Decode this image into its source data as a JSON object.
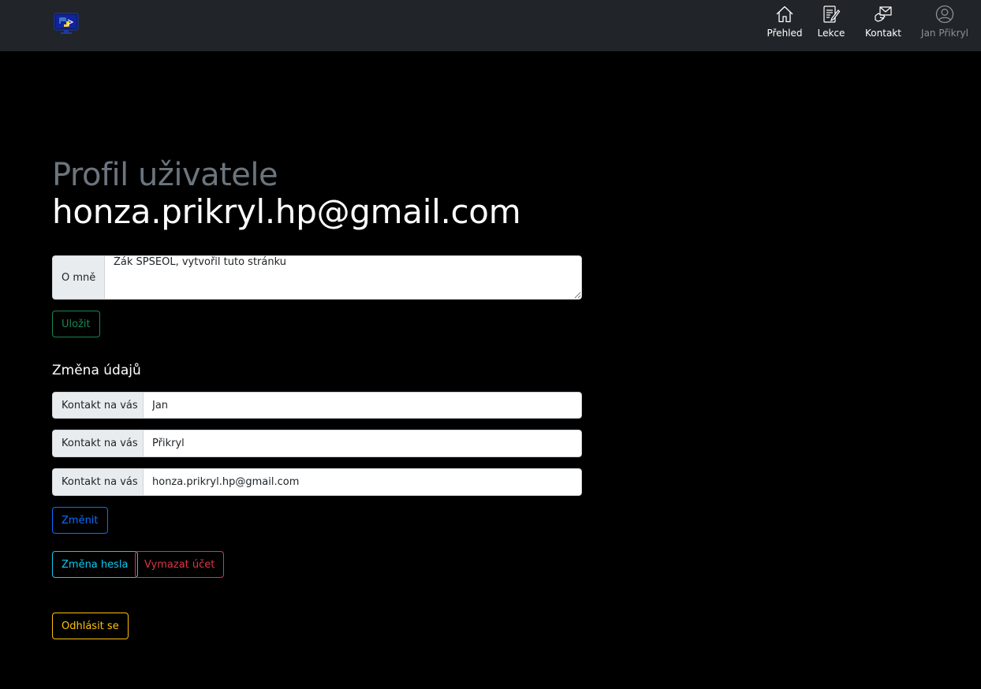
{
  "nav": {
    "items": [
      {
        "label": "Přehled",
        "icon": "house-icon"
      },
      {
        "label": "Lekce",
        "icon": "journal-pencil-icon"
      },
      {
        "label": "Kontakt",
        "icon": "envelope-handshake-icon"
      },
      {
        "label": "Jan Přikryl",
        "icon": "person-circle-icon"
      }
    ]
  },
  "header": {
    "subtitle": "Profil uživatele",
    "title": "honza.prikryl.hp@gmail.com"
  },
  "about": {
    "label": "O mně",
    "value": "Žák SPŠEOL, vytvořil tuto stránku",
    "save_label": "Uložit"
  },
  "details": {
    "heading": "Změna údajů",
    "first_name": {
      "label": "Kontakt na vás",
      "value": "Jan"
    },
    "last_name": {
      "label": "Kontakt na vás",
      "value": "Přikryl"
    },
    "email": {
      "label": "Kontakt na vás",
      "value": "honza.prikryl.hp@gmail.com"
    },
    "change_label": "Změnit"
  },
  "account": {
    "password_label": "Změna hesla",
    "delete_label": "Vymazat účet",
    "logout_label": "Odhlásit se"
  },
  "colors": {
    "navbar": "#212529",
    "background": "#000000",
    "success": "#198754",
    "primary": "#0d6efd",
    "info": "#0dcaf0",
    "danger": "#dc3545",
    "warning": "#ffc107"
  }
}
